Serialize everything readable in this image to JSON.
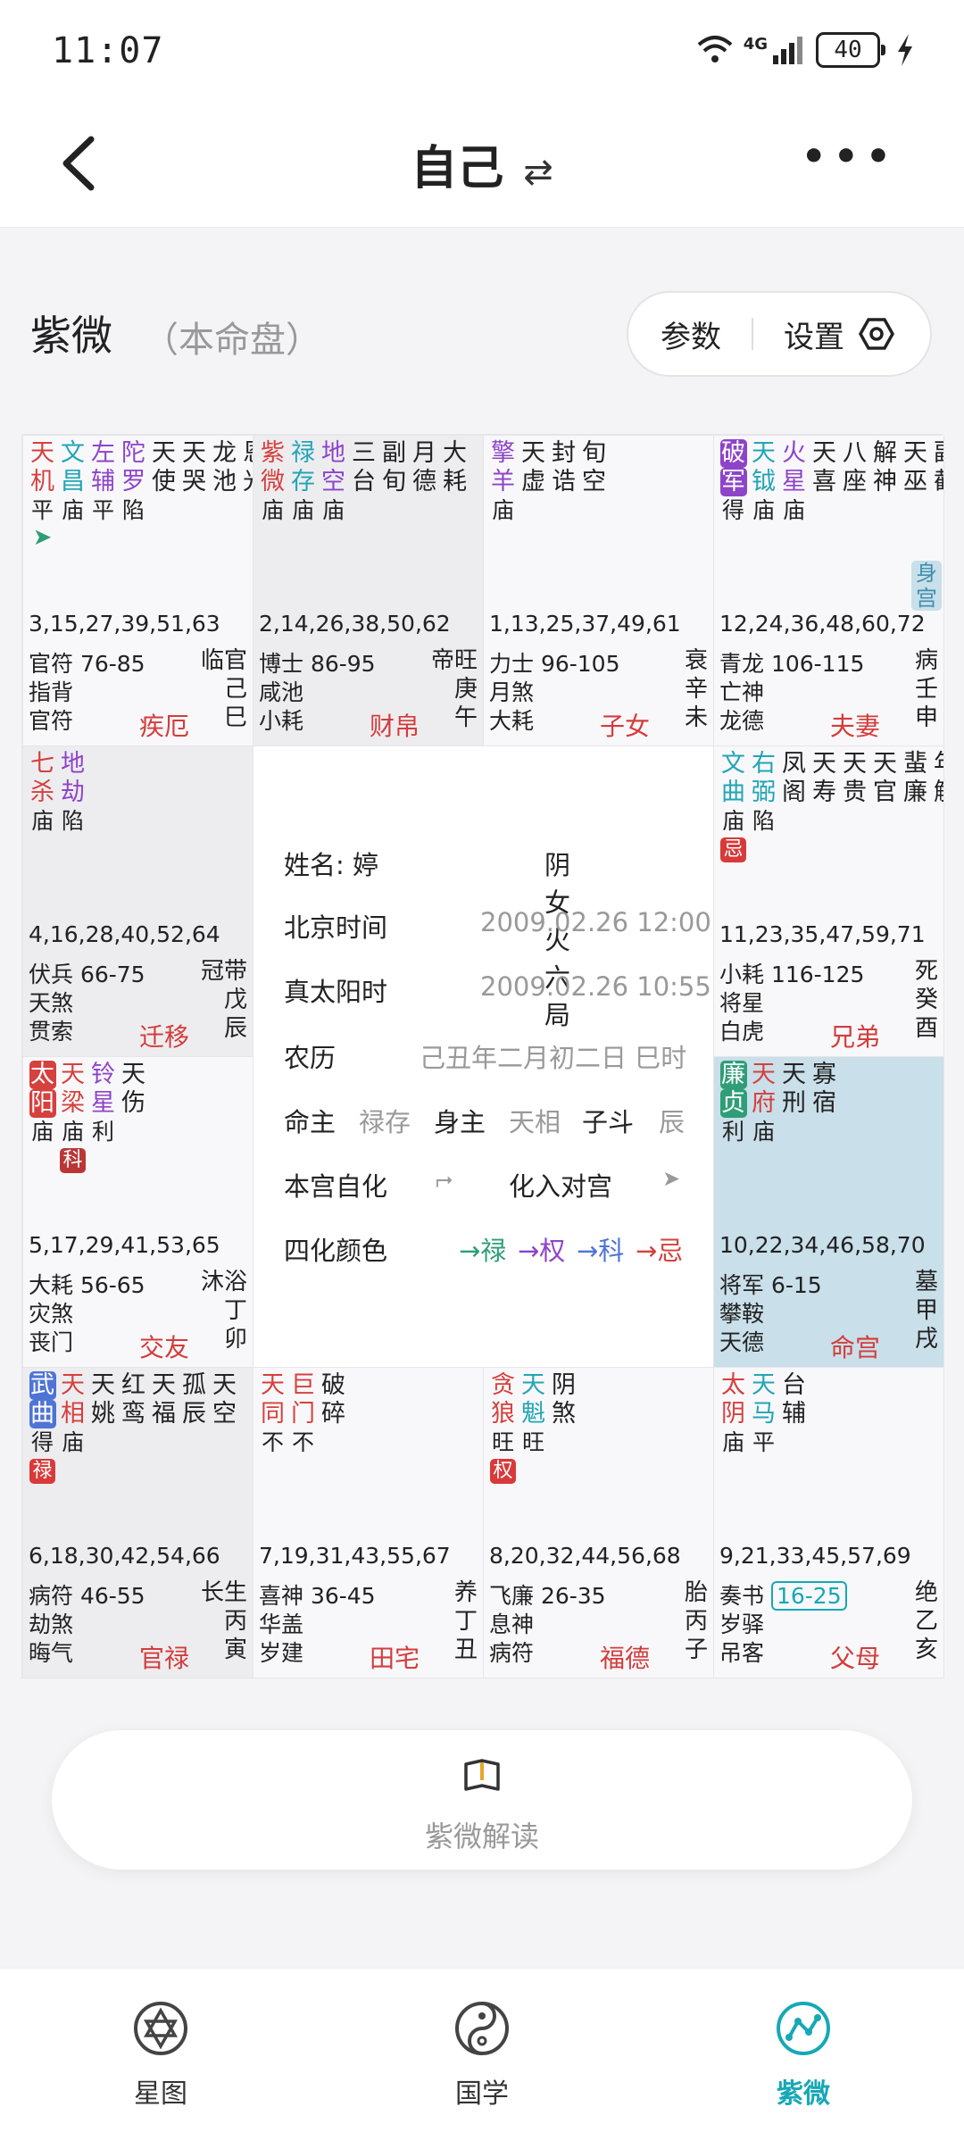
{
  "status": {
    "time": "11:07",
    "network": "4G",
    "battery": "40"
  },
  "header": {
    "title": "自己",
    "swap_icon": "swap-icon",
    "more": "•••"
  },
  "section": {
    "title": "紫微",
    "subtitle": "（本命盘）",
    "params": "参数",
    "settings": "设置"
  },
  "colors": {
    "red": "#d6403d",
    "green": "#2f9e77",
    "purple": "#8e44c9",
    "teal": "#22a5b5",
    "blue": "#4f74d6",
    "ming_bg": "#c9dfe9"
  },
  "cells": [
    {
      "stars": [
        [
          "天",
          "机",
          "平",
          "r"
        ],
        [
          "文",
          "昌",
          "庙",
          "g"
        ],
        [
          "左",
          "辅",
          "平",
          "p"
        ],
        [
          "陀",
          "罗",
          "陷",
          "p"
        ],
        [
          "天",
          "使",
          "",
          ""
        ],
        [
          "天",
          "哭",
          "",
          ""
        ],
        [
          "龙",
          "池",
          "",
          ""
        ],
        [
          "恩",
          "光",
          "",
          ""
        ]
      ],
      "arrow": "➤",
      "ages": "3,15,27,39,51,63",
      "gods": [
        "官符 76-85",
        "指背",
        "官符"
      ],
      "right": [
        "临官",
        "己",
        "巳"
      ],
      "palace": "疾厄"
    },
    {
      "stars": [
        [
          "紫",
          "微",
          "庙",
          "r"
        ],
        [
          "禄",
          "存",
          "庙",
          "g"
        ],
        [
          "地",
          "空",
          "庙",
          "p"
        ],
        [
          "三",
          "台",
          "",
          ""
        ],
        [
          "副",
          "旬",
          "",
          ""
        ],
        [
          "月",
          "德",
          "",
          ""
        ],
        [
          "大",
          "耗",
          "",
          ""
        ]
      ],
      "ages": "2,14,26,38,50,62",
      "gods": [
        "博士 86-95",
        "咸池",
        "小耗"
      ],
      "right": [
        "帝旺",
        "庚",
        "午"
      ],
      "palace": "财帛"
    },
    {
      "stars": [
        [
          "擎",
          "羊",
          "庙",
          "p"
        ],
        [
          "天",
          "虚",
          "",
          ""
        ],
        [
          "封",
          "诰",
          "",
          ""
        ],
        [
          "旬",
          "空",
          "",
          ""
        ]
      ],
      "ages": "1,13,25,37,49,61",
      "gods": [
        "力士 96-105",
        "月煞",
        "大耗"
      ],
      "right": [
        "衰",
        "辛",
        "未"
      ],
      "palace": "子女"
    },
    {
      "stars": [
        [
          "破",
          "军",
          "得",
          "hp"
        ],
        [
          "天",
          "钺",
          "庙",
          "g"
        ],
        [
          "火",
          "星",
          "庙",
          "p"
        ],
        [
          "天",
          "喜",
          "",
          ""
        ],
        [
          "八",
          "座",
          "",
          ""
        ],
        [
          "解",
          "神",
          "",
          ""
        ],
        [
          "天",
          "巫",
          "",
          ""
        ],
        [
          "副",
          "截",
          "",
          ""
        ]
      ],
      "ages": "12,24,36,48,60,72",
      "gods": [
        "青龙 106-115",
        "亡神",
        "龙德"
      ],
      "right": [
        "病",
        "壬",
        "申"
      ],
      "palace": "夫妻",
      "body": "身宫"
    },
    {
      "stars": [
        [
          "七",
          "杀",
          "庙",
          "r"
        ],
        [
          "地",
          "劫",
          "陷",
          "p"
        ]
      ],
      "ages": "4,16,28,40,52,64",
      "gods": [
        "伏兵 66-75",
        "天煞",
        "贯索"
      ],
      "right": [
        "冠带",
        "戊",
        "辰"
      ],
      "palace": "迁移"
    },
    {
      "stars": [
        [
          "文",
          "曲",
          "庙",
          "g"
        ],
        [
          "右",
          "弼",
          "陷",
          "g"
        ],
        [
          "凤",
          "阁",
          "",
          ""
        ],
        [
          "天",
          "寿",
          "",
          ""
        ],
        [
          "天",
          "贵",
          "",
          ""
        ],
        [
          "天",
          "官",
          "",
          ""
        ],
        [
          "蜚",
          "廉",
          "",
          ""
        ],
        [
          "年",
          "解",
          "",
          ""
        ]
      ],
      "tag": "忌",
      "ages": "11,23,35,47,59,71",
      "gods": [
        "小耗 116-125",
        "将星",
        "白虎"
      ],
      "right": [
        "死",
        "癸",
        "酉"
      ],
      "palace": "兄弟"
    },
    {
      "stars": [
        [
          "太",
          "阳",
          "庙",
          "hr"
        ],
        [
          "天",
          "梁",
          "庙",
          "r"
        ],
        [
          "铃",
          "星",
          "利",
          "p"
        ],
        [
          "天",
          "伤",
          "",
          ""
        ]
      ],
      "tag2": "科",
      "ages": "5,17,29,41,53,65",
      "gods": [
        "大耗 56-65",
        "灾煞",
        "丧门"
      ],
      "right": [
        "沐浴",
        "丁",
        "卯"
      ],
      "palace": "交友"
    },
    {
      "stars": [
        [
          "廉",
          "贞",
          "利",
          "hg"
        ],
        [
          "天",
          "府",
          "庙",
          "r"
        ],
        [
          "天",
          "刑",
          "",
          ""
        ],
        [
          "寡",
          "宿",
          "",
          ""
        ]
      ],
      "ages": "10,22,34,46,58,70",
      "gods": [
        "将军 6-15",
        "攀鞍",
        "天德"
      ],
      "right": [
        "墓",
        "甲",
        "戌"
      ],
      "palace": "命宫"
    },
    {
      "stars": [
        [
          "武",
          "曲",
          "得",
          "hb"
        ],
        [
          "天",
          "相",
          "庙",
          "r"
        ],
        [
          "天",
          "姚",
          "",
          ""
        ],
        [
          "红",
          "鸾",
          "",
          ""
        ],
        [
          "天",
          "福",
          "",
          ""
        ],
        [
          "孤",
          "辰",
          "",
          ""
        ],
        [
          "天",
          "空",
          "",
          ""
        ]
      ],
      "tag": "禄",
      "ages": "6,18,30,42,54,66",
      "gods": [
        "病符 46-55",
        "劫煞",
        "晦气"
      ],
      "right": [
        "长生",
        "丙",
        "寅"
      ],
      "palace": "官禄"
    },
    {
      "stars": [
        [
          "天",
          "同",
          "不",
          "r"
        ],
        [
          "巨",
          "门",
          "不",
          "r"
        ],
        [
          "破",
          "碎",
          "",
          ""
        ]
      ],
      "ages": "7,19,31,43,55,67",
      "gods": [
        "喜神 36-45",
        "华盖",
        "岁建"
      ],
      "right": [
        "养",
        "丁",
        "丑"
      ],
      "palace": "田宅"
    },
    {
      "stars": [
        [
          "贪",
          "狼",
          "旺",
          "r"
        ],
        [
          "天",
          "魁",
          "旺",
          "g"
        ],
        [
          "阴",
          "煞",
          "",
          ""
        ]
      ],
      "tag": "权",
      "ages": "8,20,32,44,56,68",
      "gods": [
        "飞廉 26-35",
        "息神",
        "病符"
      ],
      "right": [
        "胎",
        "丙",
        "子"
      ],
      "palace": "福德"
    },
    {
      "stars": [
        [
          "太",
          "阴",
          "庙",
          "r"
        ],
        [
          "天",
          "马",
          "平",
          "g"
        ],
        [
          "台",
          "辅",
          "",
          ""
        ]
      ],
      "ages": "9,21,33,45,57,69",
      "gods": [
        "奏书 16-25",
        "岁驿",
        "吊客"
      ],
      "right": [
        "绝",
        "乙",
        "亥"
      ],
      "palace": "父母"
    }
  ],
  "center": {
    "name_label": "姓名:",
    "name": "婷",
    "gender_bureau": "阴女 火六局",
    "beijing_label": "北京时间",
    "beijing": "2009.02.26 12:00",
    "solar_label": "真太阳时",
    "solar": "2009.02.26 10:55",
    "lunar_label": "农历",
    "lunar": "己丑年二月初二日 巳时",
    "ming_label": "命主",
    "ming": "禄存",
    "shen_label": "身主",
    "shen": "天相",
    "zidou_label": "子斗",
    "zidou": "辰",
    "self_label": "本宫自化",
    "opp_label": "化入对宫",
    "colors_label": "四化颜色",
    "lu": "→禄",
    "quan": "→权",
    "ke": "→科",
    "ji": "→忌"
  },
  "interp": {
    "label": "紫微解读"
  },
  "tabs": [
    {
      "label": "星图"
    },
    {
      "label": "国学"
    },
    {
      "label": "紫微"
    }
  ]
}
